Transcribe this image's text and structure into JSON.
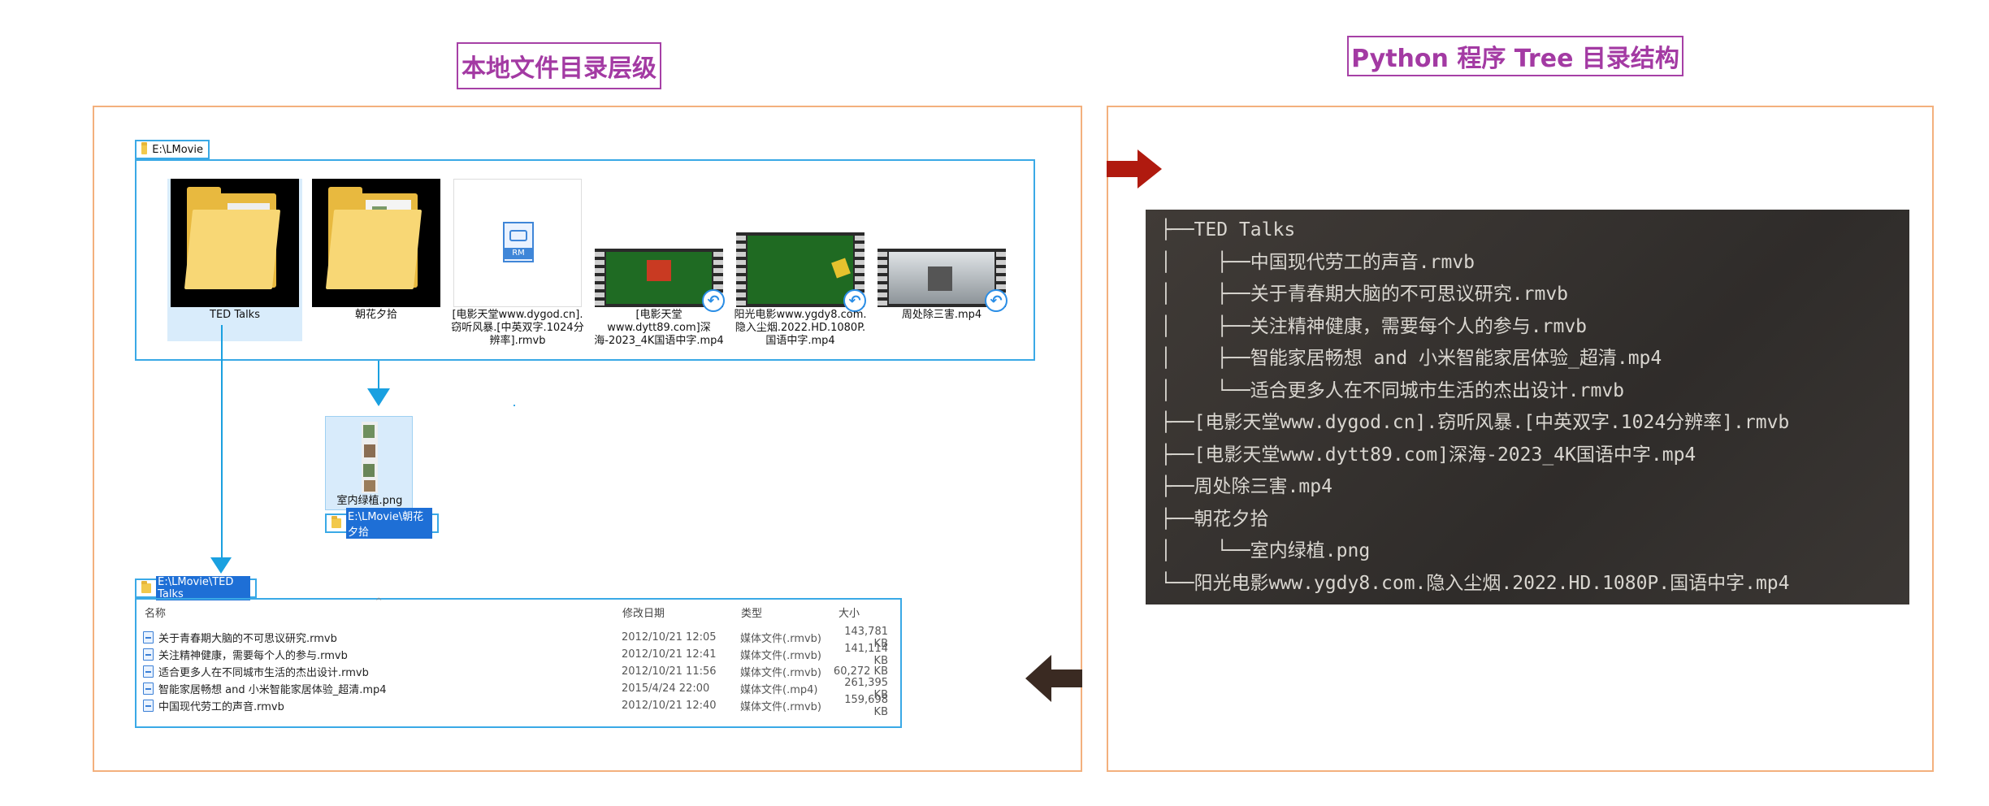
{
  "titles": {
    "left": "本地文件目录层级",
    "right": "Python 程序 Tree 目录结构"
  },
  "explorer_top": {
    "path": "E:\\LMovie",
    "tiles": [
      {
        "label": "TED Talks",
        "kind": "folder"
      },
      {
        "label": "朝花夕拾",
        "kind": "folder"
      },
      {
        "label": "[电影天堂www.dygod.cn].窃听风暴.[中英双字.1024分辨率].rmvb",
        "kind": "rm-file",
        "badge": "RM"
      },
      {
        "label": "[电影天堂www.dytt89.com]深海-2023_4K国语中字.mp4",
        "kind": "video"
      },
      {
        "label": "阳光电影www.ygdy8.com.隐入尘烟.2022.HD.1080P.国语中字.mp4",
        "kind": "video"
      },
      {
        "label": "周处除三害.mp4",
        "kind": "video"
      }
    ]
  },
  "explorer_sub": {
    "tile_label": "室内绿植.png",
    "path": "E:\\LMovie\\朝花夕拾"
  },
  "explorer_detail": {
    "path": "E:\\LMovie\\TED Talks",
    "columns": [
      "名称",
      "修改日期",
      "类型",
      "大小"
    ],
    "rows": [
      {
        "name": "关于青春期大脑的不可思议研究.rmvb",
        "date": "2012/10/21 12:05",
        "type": "媒体文件(.rmvb)",
        "size": "143,781 KB"
      },
      {
        "name": "关注精神健康，需要每个人的参与.rmvb",
        "date": "2012/10/21 12:41",
        "type": "媒体文件(.rmvb)",
        "size": "141,114 KB"
      },
      {
        "name": "适合更多人在不同城市生活的杰出设计.rmvb",
        "date": "2012/10/21 11:56",
        "type": "媒体文件(.rmvb)",
        "size": "60,272 KB"
      },
      {
        "name": "智能家居畅想 and 小米智能家居体验_超清.mp4",
        "date": "2015/4/24 22:00",
        "type": "媒体文件(.mp4)",
        "size": "261,395 KB"
      },
      {
        "name": "中国现代劳工的声音.rmvb",
        "date": "2012/10/21 12:40",
        "type": "媒体文件(.rmvb)",
        "size": "159,698 KB"
      }
    ]
  },
  "tree_lines": [
    "├──TED Talks",
    "│    ├──中国现代劳工的声音.rmvb",
    "│    ├──关于青春期大脑的不可思议研究.rmvb",
    "│    ├──关注精神健康，需要每个人的参与.rmvb",
    "│    ├──智能家居畅想 and 小米智能家居体验_超清.mp4",
    "│    └──适合更多人在不同城市生活的杰出设计.rmvb",
    "├──[电影天堂www.dygod.cn].窃听风暴.[中英双字.1024分辨率].rmvb",
    "├──[电影天堂www.dytt89.com]深海-2023_4K国语中字.mp4",
    "├──周处除三害.mp4",
    "├──朝花夕拾",
    "│    └──室内绿植.png",
    "└──阳光电影www.ygdy8.com.隐入尘烟.2022.HD.1080P.国语中字.mp4"
  ],
  "colors": {
    "title_accent": "#a33aa3",
    "panel_border": "#f3b07d",
    "explorer_blue": "#3aa9e6",
    "arrow_red": "#b01a0f",
    "arrow_dark": "#3a2a22"
  }
}
